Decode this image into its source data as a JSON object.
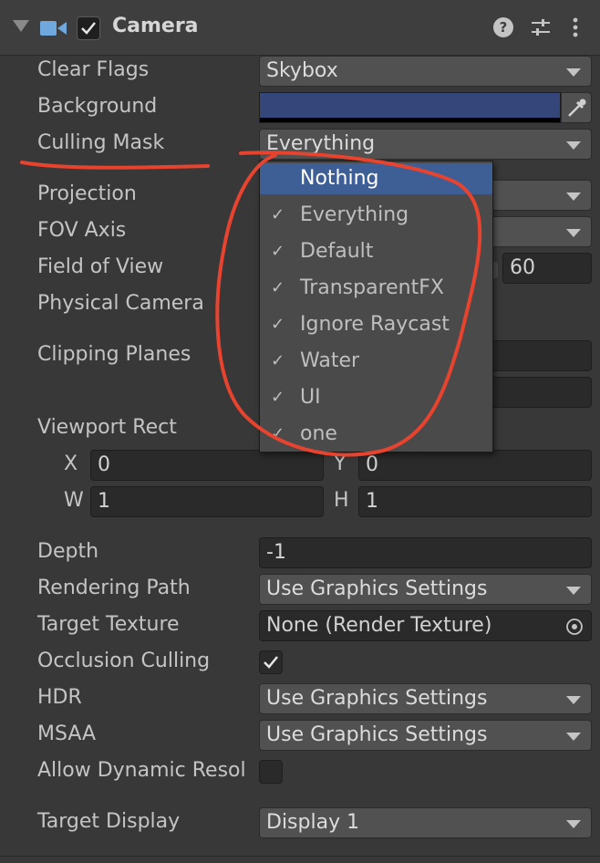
{
  "component": {
    "title": "Camera"
  },
  "fields": {
    "clear_flags": {
      "label": "Clear Flags",
      "value": "Skybox"
    },
    "background": {
      "label": "Background",
      "color": "#34467a"
    },
    "culling_mask": {
      "label": "Culling Mask",
      "value": "Everything"
    },
    "projection": {
      "label": "Projection"
    },
    "fov_axis": {
      "label": "FOV Axis"
    },
    "field_of_view": {
      "label": "Field of View",
      "value": "60"
    },
    "physical_camera": {
      "label": "Physical Camera"
    },
    "clipping_planes": {
      "label": "Clipping Planes"
    },
    "viewport_rect": {
      "label": "Viewport Rect",
      "x_label": "X",
      "x": "0",
      "y_label": "Y",
      "y": "0",
      "w_label": "W",
      "w": "1",
      "h_label": "H",
      "h": "1"
    },
    "depth": {
      "label": "Depth",
      "value": "-1"
    },
    "rendering_path": {
      "label": "Rendering Path",
      "value": "Use Graphics Settings"
    },
    "target_texture": {
      "label": "Target Texture",
      "value": "None (Render Texture)"
    },
    "occlusion_culling": {
      "label": "Occlusion Culling",
      "checked": true
    },
    "hdr": {
      "label": "HDR",
      "value": "Use Graphics Settings"
    },
    "msaa": {
      "label": "MSAA",
      "value": "Use Graphics Settings"
    },
    "allow_dynamic_resolution": {
      "label": "Allow Dynamic Resol",
      "checked": false
    },
    "target_display": {
      "label": "Target Display",
      "value": "Display 1"
    }
  },
  "culling_mask_popup": {
    "items": [
      {
        "label": "Nothing",
        "checked": false,
        "selected": true
      },
      {
        "label": "Everything",
        "checked": true
      },
      {
        "label": "Default",
        "checked": true
      },
      {
        "label": "TransparentFX",
        "checked": true
      },
      {
        "label": "Ignore Raycast",
        "checked": true
      },
      {
        "label": "Water",
        "checked": true
      },
      {
        "label": "UI",
        "checked": true
      },
      {
        "label": "one",
        "checked": true
      }
    ],
    "tick_glyph": "✓"
  },
  "colors": {
    "panel_bg": "#383838",
    "selection": "#3e5f96",
    "annotation": "#e8432e",
    "camera_icon": "#6fa8dc"
  }
}
